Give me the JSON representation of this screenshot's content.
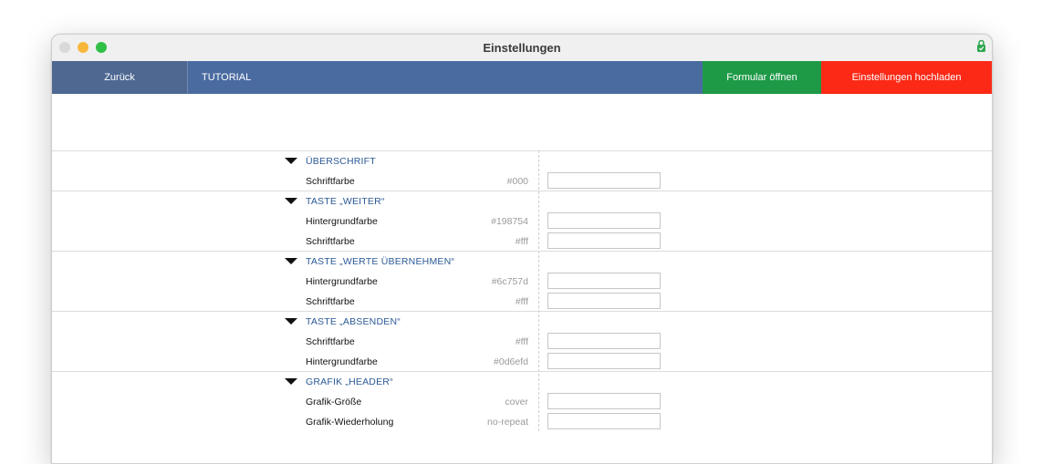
{
  "window": {
    "title": "Einstellungen",
    "lock_icon": "lock-icon",
    "traffic_light_colors": {
      "close": "#d9d9d9",
      "minimize": "#f7b83a",
      "maximize": "#30c048"
    }
  },
  "toolbar": {
    "back_label": "Zurück",
    "tutorial_label": "TUTORIAL",
    "open_form_label": "Formular öffnen",
    "upload_label": "Einstellungen hochladen",
    "colors": {
      "back": "#4e6892",
      "bar": "#4a6ba0",
      "open_form": "#1e9a47",
      "upload": "#fb2916"
    }
  },
  "sections": [
    {
      "title": "ÜBERSCHRIFT",
      "rows": [
        {
          "label": "Schriftfarbe",
          "default": "#000",
          "value": ""
        }
      ]
    },
    {
      "title": "TASTE „WEITER“",
      "rows": [
        {
          "label": "Hintergrundfarbe",
          "default": "#198754",
          "value": ""
        },
        {
          "label": "Schriftfarbe",
          "default": "#fff",
          "value": ""
        }
      ]
    },
    {
      "title": "TASTE „WERTE ÜBERNEHMEN“",
      "rows": [
        {
          "label": "Hintergrundfarbe",
          "default": "#6c757d",
          "value": ""
        },
        {
          "label": "Schriftfarbe",
          "default": "#fff",
          "value": ""
        }
      ]
    },
    {
      "title": "TASTE „ABSENDEN“",
      "rows": [
        {
          "label": "Schriftfarbe",
          "default": "#fff",
          "value": ""
        },
        {
          "label": "Hintergrundfarbe",
          "default": "#0d6efd",
          "value": ""
        }
      ]
    },
    {
      "title": "GRAFIK „HEADER“",
      "rows": [
        {
          "label": "Grafik-Größe",
          "default": "cover",
          "value": ""
        },
        {
          "label": "Grafik-Wiederholung",
          "default": "no-repeat",
          "value": ""
        }
      ]
    }
  ]
}
